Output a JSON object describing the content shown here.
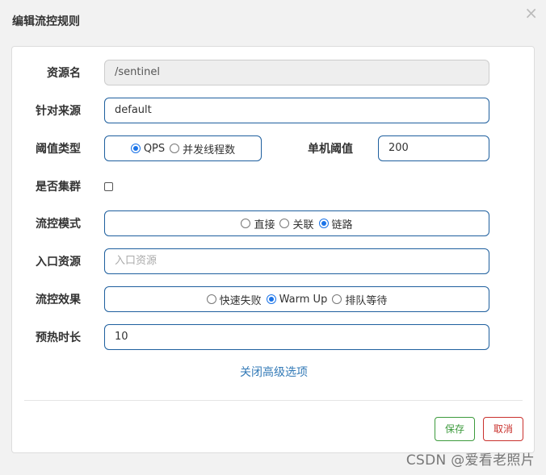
{
  "dialog": {
    "title": "编辑流控规则",
    "close_glyph": "×"
  },
  "form": {
    "resource_name": {
      "label": "资源名",
      "value": "/sentinel"
    },
    "limit_app": {
      "label": "针对来源",
      "value": "default"
    },
    "grade": {
      "label": "阈值类型",
      "options": [
        {
          "label": "QPS",
          "checked": true
        },
        {
          "label": "并发线程数",
          "checked": false
        }
      ]
    },
    "count": {
      "label": "单机阈值",
      "value": "200"
    },
    "cluster": {
      "label": "是否集群",
      "checked": false
    },
    "strategy": {
      "label": "流控模式",
      "options": [
        {
          "label": "直接",
          "checked": false
        },
        {
          "label": "关联",
          "checked": false
        },
        {
          "label": "链路",
          "checked": true
        }
      ]
    },
    "ref_resource": {
      "label": "入口资源",
      "placeholder": "入口资源"
    },
    "control_behavior": {
      "label": "流控效果",
      "options": [
        {
          "label": "快速失败",
          "checked": false
        },
        {
          "label": "Warm Up",
          "checked": true
        },
        {
          "label": "排队等待",
          "checked": false
        }
      ]
    },
    "warm_up_period": {
      "label": "预热时长",
      "value": "10"
    },
    "advanced_toggle": "关闭高级选项"
  },
  "footer": {
    "save_label": "保存",
    "cancel_label": "取消"
  },
  "watermark": "CSDN @爱看老照片",
  "colors": {
    "accent": "#1a73e8",
    "input_border": "#1e5f9e",
    "link": "#337ab7",
    "save": "#3c9a3c",
    "cancel": "#c9302c"
  }
}
